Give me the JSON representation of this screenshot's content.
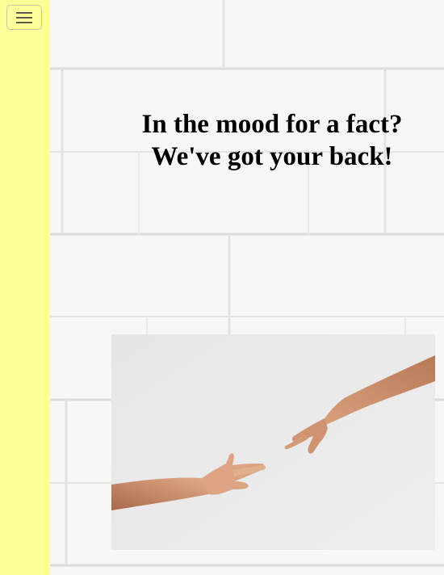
{
  "menu": {
    "icon": "hamburger-menu-icon"
  },
  "hero": {
    "headline_line1": "In the mood for a fact?",
    "headline_line2": "We've got your back!"
  },
  "image": {
    "subject": "two-hands-reaching-image"
  },
  "colors": {
    "sidebar": "#ffff99",
    "wall": "#f4f4f2",
    "photo_background": "#e9e9e9",
    "skin": "#d49a76",
    "headline": "#000000"
  }
}
